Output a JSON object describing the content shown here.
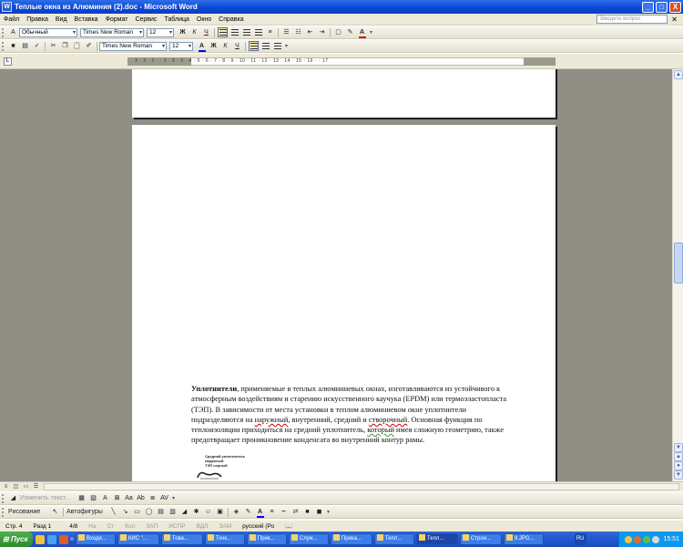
{
  "window": {
    "title": "Теплые окна из Алюминия (2).doc - Microsoft Word",
    "icon_label": "W",
    "minimize": "_",
    "maximize": "□",
    "close": "X"
  },
  "menu": {
    "items": [
      "Файл",
      "Правка",
      "Вид",
      "Вставка",
      "Формат",
      "Сервис",
      "Таблица",
      "Окно",
      "Справка"
    ],
    "help_placeholder": "Введите вопрос",
    "close_glyph": "✕"
  },
  "formatting_toolbar": {
    "style": "Обычный",
    "font": "Times New Roman",
    "size": "12",
    "bold": "Ж",
    "italic": "К",
    "underline": "Ч"
  },
  "standard_toolbar": {
    "font": "Times New Roman",
    "size": "12",
    "bold": "Ж",
    "italic": "К",
    "underline": "Ч"
  },
  "ruler": {
    "corner": "L",
    "numbers": "3 · 2 · 1 ·  · 1 · 2 · 3 · 4 · 5 · 6 · 7 · 8 · 9 · 10 · 11 · 12 · 13 · 14 · 15 · 16 ·  · 17"
  },
  "document": {
    "para_bold": "Уплотнители",
    "para_p1": ", применяемые в теплых алюминиевых окнах, изготавливаются из устойчивого к атмосферным воздействиям и старению искусственного каучука (EPDM) или термоэластопласта (ТЭП). В зависимости от места установки в теплом алюминиевом окне уплотнители  подразделяются на ",
    "word_naruzh": "наружный",
    "para_p2": ", внутренний, средний и ",
    "word_stvor": "створочный",
    "para_p3": ". Основная функция по теплоизоляции приходиться на средний уплотнитель, ",
    "word_kotory": "который",
    "para_p4": " имея сложную геометрию, также предотвращает проникновение конденсата во внутренний контур рамы.",
    "caption_l1": "Средний уплотнитель",
    "caption_l2": "наружный",
    "caption_l3": "ТЭП черный"
  },
  "picture_toolbar": {
    "change_text": "Изменить текст...",
    "kerning": "AV"
  },
  "draw_toolbar": {
    "draw": "Рисование",
    "autoshapes": "Автофигуры"
  },
  "statusbar": {
    "page": "Стр. 4",
    "section": "Разд 1",
    "pages": "4/8",
    "at": "На",
    "line": "Ст",
    "col": "Кол",
    "rec": "ЗАП",
    "trk": "ИСПР",
    "ext": "ВДЛ",
    "ovr": "ЗАМ",
    "lang": "русский (Ро"
  },
  "taskbar": {
    "start": "Пуск",
    "more": "»",
    "tasks": [
      {
        "label": "Входя...",
        "active": false
      },
      {
        "label": "КИС \"...",
        "active": false
      },
      {
        "label": "Това...",
        "active": false
      },
      {
        "label": "Точк...",
        "active": false
      },
      {
        "label": "Прик...",
        "active": false
      },
      {
        "label": "Служ...",
        "active": false
      },
      {
        "label": "Прика...",
        "active": false
      },
      {
        "label": "Тепл...",
        "active": false
      },
      {
        "label": "Тепл...",
        "active": true
      },
      {
        "label": "Строи...",
        "active": false
      },
      {
        "label": "9.JPG...",
        "active": false
      }
    ],
    "lang": "RU",
    "clock": "15:51"
  },
  "colors": {
    "title_bar": "#0a46d6",
    "doc_background": "#8f8f86",
    "taskbar": "#2157d0",
    "start_button": "#3f9b3b"
  }
}
